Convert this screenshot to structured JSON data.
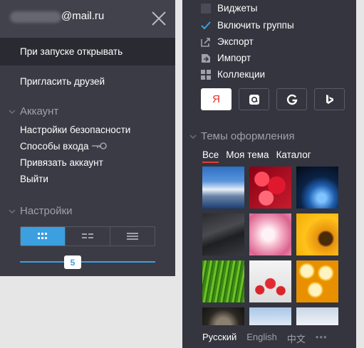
{
  "account": {
    "email_domain": "@mail.ru"
  },
  "left_menu": {
    "on_startup": "При запуске открывать",
    "invite_friends": "Пригласить друзей",
    "account_section": "Аккаунт",
    "security_settings": "Настройки безопасности",
    "login_methods": "Способы входа",
    "link_account": "Привязать аккаунт",
    "logout": "Выйти",
    "settings_section": "Настройки",
    "view_modes": [
      "grid-large",
      "grid-small",
      "list"
    ],
    "active_view_mode": "grid-large",
    "slider_value": "5"
  },
  "right_menu": {
    "widgets": "Виджеты",
    "enable_groups": "Включить группы",
    "export": "Экспорт",
    "import": "Импорт",
    "collections": "Коллекции",
    "search_engines": [
      "Яндекс",
      "Mail.ru",
      "Google",
      "Bing"
    ],
    "active_engine": "Яндекс",
    "yandex_letter": "Я",
    "themes_section": "Темы оформления",
    "theme_tabs": [
      "Все",
      "Моя тема",
      "Каталог"
    ],
    "active_theme_tab": "Все",
    "themes": [
      "mountains",
      "pomegranate",
      "earth",
      "dark-texture",
      "peony",
      "sunflower",
      "grass",
      "red-berries",
      "honeycomb",
      "dark-clock",
      "sky",
      "clouds"
    ]
  },
  "languages": {
    "items": [
      "Русский",
      "English",
      "中文"
    ],
    "active": "Русский",
    "more": "•••"
  },
  "colors": {
    "accent": "#3b9fe0",
    "panel_left": "#3a3b45",
    "panel_right": "#34353e",
    "tab_underline": "#e23b3b",
    "yandex_red": "#e5302a"
  }
}
